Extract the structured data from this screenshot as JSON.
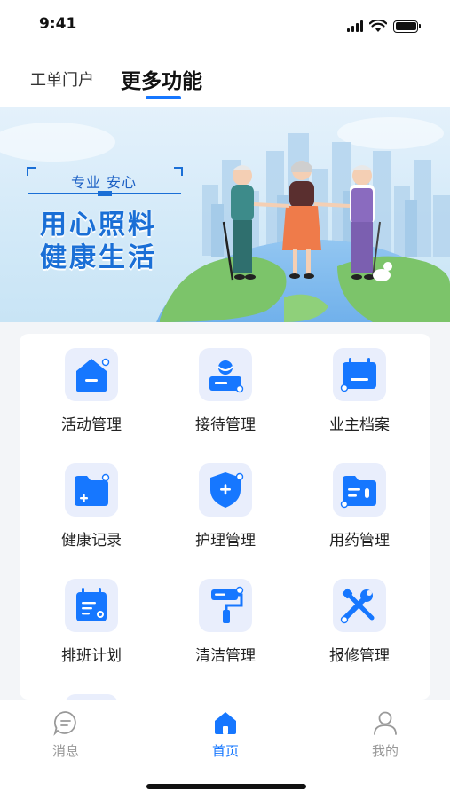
{
  "status_bar": {
    "time": "9:41"
  },
  "top_tabs": {
    "work_order_portal": "工单门户",
    "more_functions": "更多功能"
  },
  "banner": {
    "subtitle": "专业 安心",
    "title_line1": "用心照料",
    "title_line2": "健康生活",
    "accent_color": "#1a6fd6"
  },
  "functions": [
    {
      "label": "活动管理",
      "icon": "house-icon"
    },
    {
      "label": "接待管理",
      "icon": "reception-icon"
    },
    {
      "label": "业主档案",
      "icon": "calendar-folder-icon"
    },
    {
      "label": "健康记录",
      "icon": "folder-plus-icon"
    },
    {
      "label": "护理管理",
      "icon": "shield-plus-icon"
    },
    {
      "label": "用药管理",
      "icon": "medicine-folder-icon"
    },
    {
      "label": "排班计划",
      "icon": "schedule-icon"
    },
    {
      "label": "清洁管理",
      "icon": "paint-roller-icon"
    },
    {
      "label": "报修管理",
      "icon": "tools-icon"
    }
  ],
  "bottom_nav": {
    "messages": "消息",
    "home": "首页",
    "mine": "我的",
    "active": "home",
    "active_color": "#1677ff",
    "inactive_color": "#999999"
  }
}
